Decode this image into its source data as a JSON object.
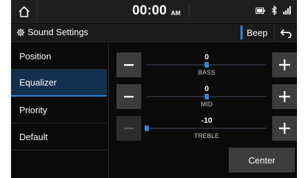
{
  "status": {
    "time": "00:00",
    "ampm": "AM"
  },
  "header": {
    "title": "Sound Settings",
    "beep_label": "Beep"
  },
  "menu": {
    "items": [
      {
        "label": "Position"
      },
      {
        "label": "Equalizer"
      },
      {
        "label": "Priority"
      },
      {
        "label": "Default"
      }
    ],
    "active": "Equalizer"
  },
  "equalizer": {
    "bands": [
      {
        "label": "BASS",
        "value": "0"
      },
      {
        "label": "MID",
        "value": "0"
      },
      {
        "label": "TREBLE",
        "value": "-10"
      }
    ],
    "range": [
      -10,
      10
    ]
  },
  "center_label": "Center",
  "colors": {
    "accent": "#2f86e0",
    "active_bg": "#14304f"
  },
  "icons": [
    "home-icon",
    "gear-icon",
    "back-arrow-icon",
    "battery-icon",
    "bluetooth-icon",
    "signal-icon",
    "minus-icon",
    "plus-icon"
  ]
}
